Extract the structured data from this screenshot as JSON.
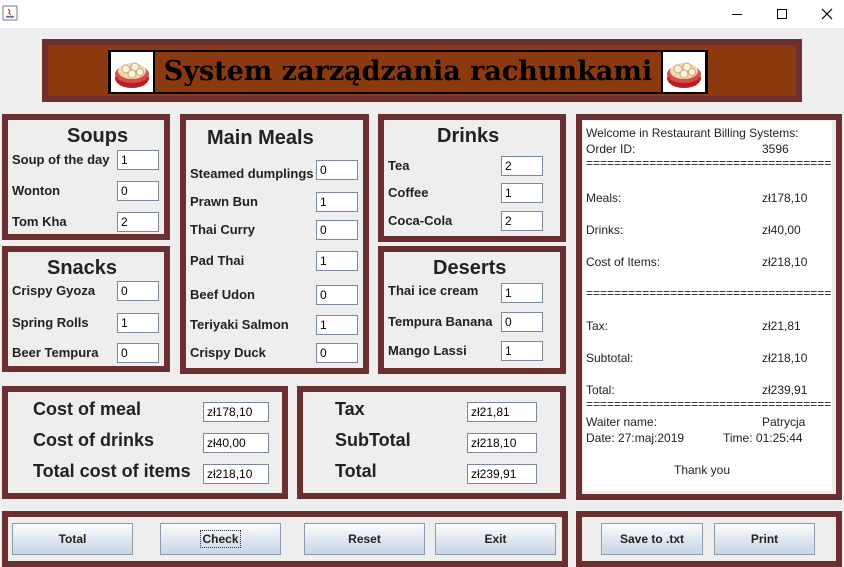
{
  "window": {
    "minimize_icon": "minimize-icon",
    "maximize_icon": "maximize-icon",
    "close_icon": "close-icon"
  },
  "header": {
    "title": "System zarządzania rachunkami"
  },
  "soups": {
    "title": "Soups",
    "items": [
      {
        "label": "Soup of the day",
        "value": "1"
      },
      {
        "label": "Wonton",
        "value": "0"
      },
      {
        "label": "Tom Kha",
        "value": "2"
      }
    ]
  },
  "snacks": {
    "title": "Snacks",
    "items": [
      {
        "label": "Crispy Gyoza",
        "value": "0"
      },
      {
        "label": "Spring Rolls",
        "value": "1"
      },
      {
        "label": "Beer Tempura",
        "value": "0"
      }
    ]
  },
  "main_meals": {
    "title": "Main Meals",
    "items": [
      {
        "label": "Steamed dumplings",
        "value": "0"
      },
      {
        "label": "Prawn Bun",
        "value": "1"
      },
      {
        "label": "Thai Curry",
        "value": "0"
      },
      {
        "label": "Pad Thai",
        "value": "1"
      },
      {
        "label": "Beef Udon",
        "value": "0"
      },
      {
        "label": "Teriyaki Salmon",
        "value": "1"
      },
      {
        "label": "Crispy Duck",
        "value": "0"
      }
    ]
  },
  "drinks": {
    "title": "Drinks",
    "items": [
      {
        "label": "Tea",
        "value": "2"
      },
      {
        "label": "Coffee",
        "value": "1"
      },
      {
        "label": "Coca-Cola",
        "value": "2"
      }
    ]
  },
  "deserts": {
    "title": "Deserts",
    "items": [
      {
        "label": "Thai ice cream",
        "value": "1"
      },
      {
        "label": "Tempura Banana",
        "value": "0"
      },
      {
        "label": "Mango Lassi",
        "value": "1"
      }
    ]
  },
  "costs": {
    "meal_label": "Cost of meal",
    "meal_value": "zł178,10",
    "drinks_label": "Cost of drinks",
    "drinks_value": "zł40,00",
    "total_items_label": "Total cost of items",
    "total_items_value": "zł218,10"
  },
  "totals": {
    "tax_label": "Tax",
    "tax_value": "zł21,81",
    "subtotal_label": "SubTotal",
    "subtotal_value": "zł218,10",
    "total_label": "Total",
    "total_value": "zł239,91"
  },
  "receipt": {
    "welcome": "Welcome in Restaurant Billing Systems:",
    "order_label": "Order ID:",
    "order_id": "3596",
    "separator": "========================================",
    "meals_label": "Meals:",
    "meals_value": "zł178,10",
    "drinks_label": "Drinks:",
    "drinks_value": "zł40,00",
    "cost_label": "Cost of Items:",
    "cost_value": "zł218,10",
    "tax_label": "Tax:",
    "tax_value": "zł21,81",
    "subtotal_label": "Subtotal:",
    "subtotal_value": "zł218,10",
    "total_label": "Total:",
    "total_value": "zł239,91",
    "waiter_label": "Waiter name:",
    "waiter_name": "Patrycja",
    "date": "Date: 27:maj:2019",
    "time": "Time: 01:25:44",
    "thanks": "Thank you"
  },
  "buttons": {
    "total": "Total",
    "check": "Check",
    "reset": "Reset",
    "exit": "Exit",
    "save": "Save to .txt",
    "print": "Print"
  }
}
